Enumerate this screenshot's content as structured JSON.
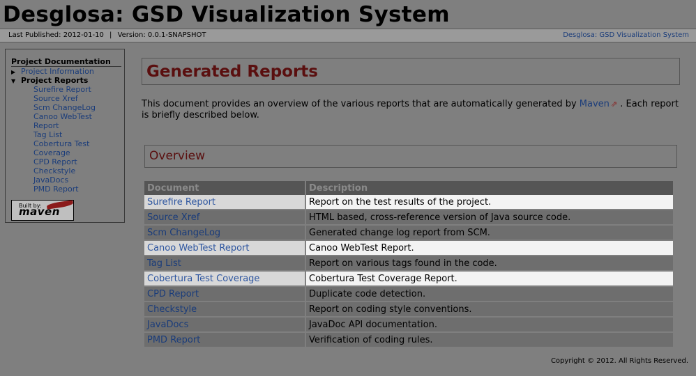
{
  "banner": {
    "title": "Desglosa: GSD Visualization System"
  },
  "breadcrumbs": {
    "last_published": "Last Published: 2012-01-10",
    "version": "Version: 0.0.1-SNAPSHOT",
    "right_link": "Desglosa: GSD Visualization System"
  },
  "nav": {
    "heading": "Project Documentation",
    "items": [
      {
        "label": "Project Information",
        "expanded": false
      },
      {
        "label": "Project Reports",
        "expanded": true
      }
    ],
    "sub_items": [
      "Surefire Report",
      "Source Xref",
      "Scm ChangeLog",
      "Canoo WebTest",
      "Report",
      "Tag List",
      "Cobertura Test",
      "Coverage",
      "CPD Report",
      "Checkstyle",
      "JavaDocs",
      "PMD Report"
    ],
    "powered_by": {
      "line1": "Built by:",
      "line2": "maven"
    }
  },
  "main": {
    "title": "Generated Reports",
    "intro_before": "This document provides an overview of the various reports that are automatically generated by ",
    "intro_link": "Maven",
    "intro_after": " . Each report is briefly described below.",
    "overview_title": "Overview",
    "table": {
      "headers": [
        "Document",
        "Description"
      ],
      "rows": [
        {
          "doc": "Surefire Report",
          "desc": "Report on the test results of the project."
        },
        {
          "doc": "Source Xref",
          "desc": "HTML based, cross-reference version of Java source code."
        },
        {
          "doc": "Scm ChangeLog",
          "desc": "Generated change log report from SCM."
        },
        {
          "doc": "Canoo WebTest Report",
          "desc": "Canoo WebTest Report."
        },
        {
          "doc": "Tag List",
          "desc": "Report on various tags found in the code."
        },
        {
          "doc": "Cobertura Test Coverage",
          "desc": "Cobertura Test Coverage Report."
        },
        {
          "doc": "CPD Report",
          "desc": "Duplicate code detection."
        },
        {
          "doc": "Checkstyle",
          "desc": "Report on coding style conventions."
        },
        {
          "doc": "JavaDocs",
          "desc": "JavaDoc API documentation."
        },
        {
          "doc": "PMD Report",
          "desc": "Verification of coding rules."
        }
      ]
    }
  },
  "footer": {
    "copyright": "Copyright © 2012. All Rights Reserved."
  },
  "colors": {
    "link": "#1a3c7a",
    "heading": "#5a0f0f",
    "background": "#7f7f7f"
  }
}
